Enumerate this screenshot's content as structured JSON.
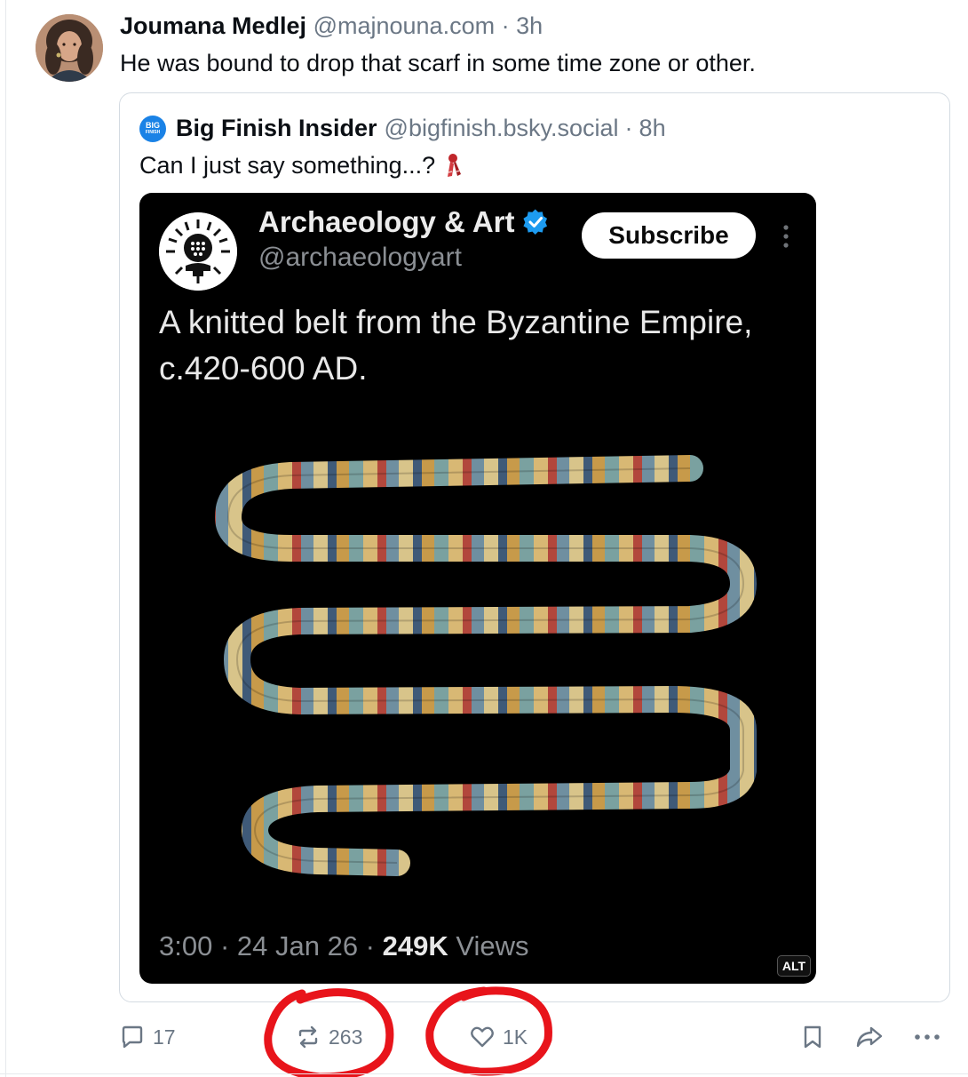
{
  "post": {
    "author_name": "Joumana Medlej",
    "author_handle": "@majnouna.com",
    "separator": "·",
    "time": "3h",
    "text": "He was bound to drop that scarf in some time zone or other."
  },
  "quoted_post": {
    "avatar_text_top": "BIG",
    "avatar_text_bottom": "FINISH",
    "author_name": "Big Finish Insider",
    "author_handle": "@bigfinish.bsky.social",
    "separator": "·",
    "time": "8h",
    "text": "Can I just say something...?",
    "emoji": "scarf-icon"
  },
  "embedded_image": {
    "account_name": "Archaeology & Art",
    "account_handle": "@archaeologyart",
    "subscribe_label": "Subscribe",
    "body": "A knitted belt from the Byzantine Empire, c.420-600 AD.",
    "footer_time": "3:00 · 24 Jan 26 ·",
    "footer_views_count": "249K",
    "footer_views_label": "Views",
    "alt_label": "ALT"
  },
  "actions": {
    "replies": "17",
    "reposts": "263",
    "likes": "1K"
  },
  "colors": {
    "muted": "#6b7785",
    "annotation_red": "#e8141b",
    "verified_blue": "#1d9bf0",
    "bsky_blue": "#1a82e6"
  }
}
